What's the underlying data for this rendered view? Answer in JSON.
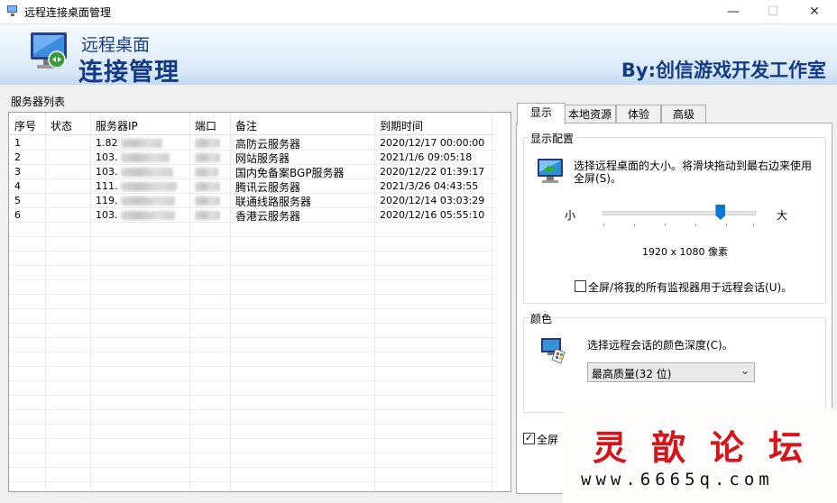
{
  "window": {
    "title": "远程连接桌面管理",
    "minimize_glyph": "—",
    "maximize_glyph": "☐",
    "close_glyph": "✕"
  },
  "banner": {
    "subtitle": "远程桌面",
    "title": "连接管理",
    "author": "By:创信游戏开发工作室",
    "icon": "remote-desktop-icon"
  },
  "server_list": {
    "label": "服务器列表",
    "columns": [
      "序号",
      "状态",
      "服务器IP",
      "端口",
      "备注",
      "到期时间"
    ],
    "rows": [
      {
        "no": "1",
        "status": "",
        "ip": "1.82",
        "note": "高防云服务器",
        "expire": "2020/12/17 00:00:00"
      },
      {
        "no": "2",
        "status": "",
        "ip": "103.",
        "note": "网站服务器",
        "expire": "2021/1/6 09:05:18"
      },
      {
        "no": "3",
        "status": "",
        "ip": "103.",
        "note": "国内免备案BGP服务器",
        "expire": "2020/12/22 01:39:17"
      },
      {
        "no": "4",
        "status": "",
        "ip": "111.",
        "note": "腾讯云服务器",
        "expire": "2021/3/26 04:43:55"
      },
      {
        "no": "5",
        "status": "",
        "ip": "119.",
        "note": "联通线路服务器",
        "expire": "2020/12/14 03:03:29"
      },
      {
        "no": "6",
        "status": "",
        "ip": "103.",
        "note": "香港云服务器",
        "expire": "2020/12/16 05:55:10"
      }
    ]
  },
  "tabs": [
    "显示",
    "本地资源",
    "体验",
    "高级"
  ],
  "display_config": {
    "group_title": "显示配置",
    "description": "选择远程桌面的大小。将滑块拖动到最右边来使用全屏(S)。",
    "slider_min_label": "小",
    "slider_max_label": "大",
    "slider_position": 0.77,
    "resolution": "1920 x 1080 像素",
    "all_monitors_label": "全屏/将我的所有监视器用于远程会话(U)。",
    "all_monitors_checked": false
  },
  "color": {
    "group_title": "颜色",
    "description": "选择远程会话的颜色深度(C)。",
    "selected": "最高质量(32 位)"
  },
  "bottom": {
    "fullscreen_checkbox_label": "全屏",
    "fullscreen_checked": true
  },
  "watermark": {
    "title": "灵歆论坛",
    "url": "www.6665q.com"
  }
}
